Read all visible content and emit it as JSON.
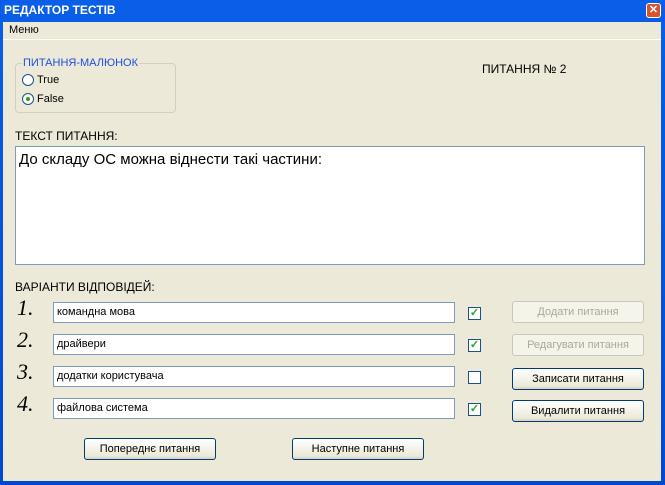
{
  "window": {
    "title": "РЕДАКТОР ТЕСТІВ",
    "close": "✕"
  },
  "menu": {
    "label": "Меню"
  },
  "picture_group": {
    "label": "ПИТАННЯ-МАЛЮНОК",
    "options": [
      {
        "label": "True",
        "selected": false
      },
      {
        "label": "False",
        "selected": true
      }
    ]
  },
  "question_number": "ПИТАННЯ № 2",
  "question_text_label": "ТЕКСТ ПИТАННЯ:",
  "question_text": "До складу ОС можна віднести такі частини:",
  "answers_label": "ВАРІАНТИ ВІДПОВІДЕЙ:",
  "answers": [
    {
      "num": "1.",
      "text": "командна мова",
      "checked": true
    },
    {
      "num": "2.",
      "text": "драйвери",
      "checked": true
    },
    {
      "num": "3.",
      "text": "додатки користувача",
      "checked": false
    },
    {
      "num": "4.",
      "text": "файлова система",
      "checked": true
    }
  ],
  "buttons": {
    "add": "Додати питання",
    "edit": "Редагувати питання",
    "save": "Записати питання",
    "delete": "Видалити питання",
    "prev": "Попереднє питання",
    "next": "Наступне питання"
  }
}
